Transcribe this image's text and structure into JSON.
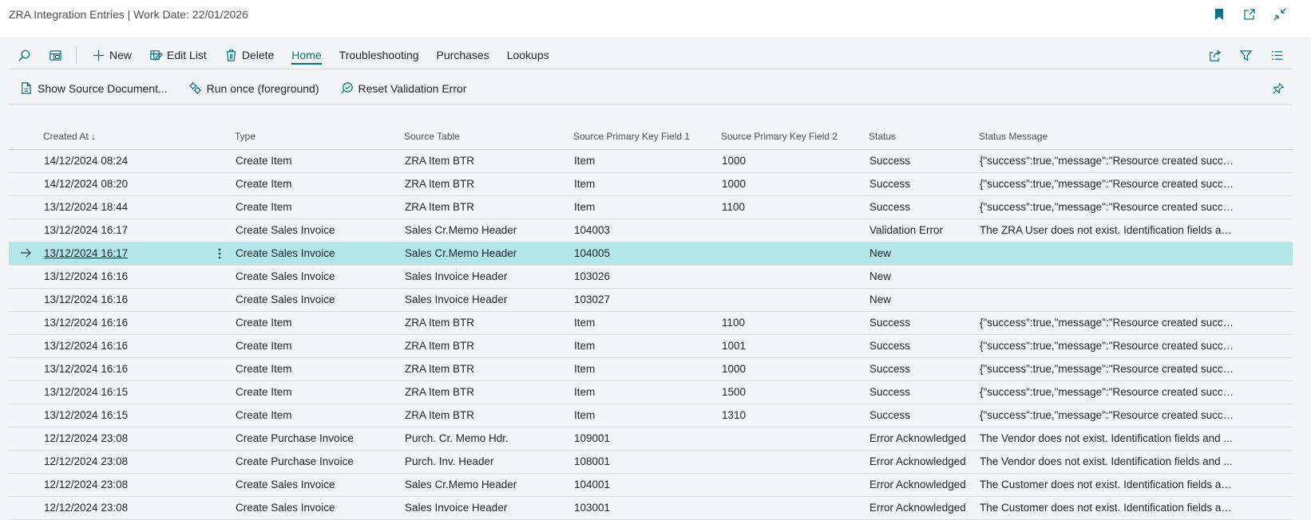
{
  "title": "ZRA Integration Entries | Work Date: 22/01/2026",
  "title_icons": [
    "bookmark-icon",
    "open-new-window-icon",
    "collapse-icon"
  ],
  "commands": {
    "search_icon": "search-icon",
    "layout_icon": "layout-icon",
    "new_label": "New",
    "edit_list_label": "Edit List",
    "delete_label": "Delete",
    "tabs": [
      "Home",
      "Troubleshooting",
      "Purchases",
      "Lookups"
    ],
    "active_tab": "Home",
    "right_icons": [
      "share-icon",
      "filter-icon",
      "list-view-icon"
    ]
  },
  "actions": {
    "show_source": "Show Source Document...",
    "run_once": "Run once (foreground)",
    "reset_validation": "Reset Validation Error"
  },
  "columns": [
    "Created At ↓",
    "Type",
    "Source Table",
    "Source Primary Key Field 1",
    "Source Primary Key Field 2",
    "Status",
    "Status Message"
  ],
  "rows": [
    [
      "14/12/2024 08:24",
      "Create Item",
      "ZRA Item BTR",
      "Item",
      "1000",
      "Success",
      "{\"success\":true,\"message\":\"Resource created succes..."
    ],
    [
      "14/12/2024 08:20",
      "Create Item",
      "ZRA Item BTR",
      "Item",
      "1000",
      "Success",
      "{\"success\":true,\"message\":\"Resource created succes..."
    ],
    [
      "13/12/2024 18:44",
      "Create Item",
      "ZRA Item BTR",
      "Item",
      "1100",
      "Success",
      "{\"success\":true,\"message\":\"Resource created succes..."
    ],
    [
      "13/12/2024 16:17",
      "Create Sales Invoice",
      "Sales Cr.Memo Header",
      "104003",
      "",
      "Validation Error",
      "The ZRA User does not exist. Identification fields an..."
    ],
    [
      "13/12/2024 16:17",
      "Create Sales Invoice",
      "Sales Cr.Memo Header",
      "104005",
      "",
      "New",
      ""
    ],
    [
      "13/12/2024 16:16",
      "Create Sales Invoice",
      "Sales Invoice Header",
      "103026",
      "",
      "New",
      ""
    ],
    [
      "13/12/2024 16:16",
      "Create Sales Invoice",
      "Sales Invoice Header",
      "103027",
      "",
      "New",
      ""
    ],
    [
      "13/12/2024 16:16",
      "Create Item",
      "ZRA Item BTR",
      "Item",
      "1100",
      "Success",
      "{\"success\":true,\"message\":\"Resource created succes..."
    ],
    [
      "13/12/2024 16:16",
      "Create Item",
      "ZRA Item BTR",
      "Item",
      "1001",
      "Success",
      "{\"success\":true,\"message\":\"Resource created succes..."
    ],
    [
      "13/12/2024 16:16",
      "Create Item",
      "ZRA Item BTR",
      "Item",
      "1000",
      "Success",
      "{\"success\":true,\"message\":\"Resource created succes..."
    ],
    [
      "13/12/2024 16:15",
      "Create Item",
      "ZRA Item BTR",
      "Item",
      "1500",
      "Success",
      "{\"success\":true,\"message\":\"Resource created succes..."
    ],
    [
      "13/12/2024 16:15",
      "Create Item",
      "ZRA Item BTR",
      "Item",
      "1310",
      "Success",
      "{\"success\":true,\"message\":\"Resource created succes..."
    ],
    [
      "12/12/2024 23:08",
      "Create Purchase Invoice",
      "Purch. Cr. Memo Hdr.",
      "109001",
      "",
      "Error Acknowledged",
      "The Vendor does not exist. Identification fields and ..."
    ],
    [
      "12/12/2024 23:08",
      "Create Purchase Invoice",
      "Purch. Inv. Header",
      "108001",
      "",
      "Error Acknowledged",
      "The Vendor does not exist. Identification fields and ..."
    ],
    [
      "12/12/2024 23:08",
      "Create Sales Invoice",
      "Sales Cr.Memo Header",
      "104001",
      "",
      "Error Acknowledged",
      "The Customer does not exist. Identification fields an..."
    ],
    [
      "12/12/2024 23:08",
      "Create Sales Invoice",
      "Sales Invoice Header",
      "103001",
      "",
      "Error Acknowledged",
      "The Customer does not exist. Identification fields an..."
    ]
  ],
  "selected_row": 4,
  "accent_color": "#00788a",
  "selected_row_color": "#b1e6ea"
}
